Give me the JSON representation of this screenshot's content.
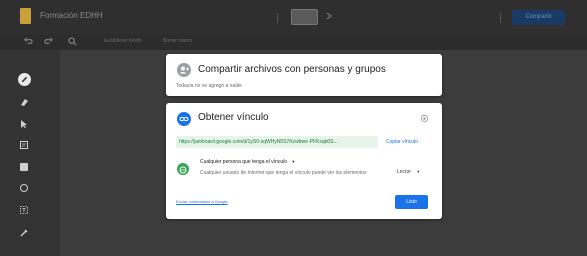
{
  "app": {
    "title": "Formación EDHH",
    "share_label": "Compartir"
  },
  "toolbar": {
    "items": [
      "Establecer fondo",
      "Borrar marco"
    ]
  },
  "share_dialog": {
    "title": "Compartir archivos con personas y grupos",
    "subtitle": "Todavía no se agregó a nadie"
  },
  "link_dialog": {
    "title": "Obtener vínculo",
    "url": "https://jamboard.google.com/d/1yS0-sqWHyN0S7Kzwbwe-PFKsqb0S...",
    "copy_label": "Copiar vínculo",
    "access_title": "Cualquier persona que tenga el vínculo",
    "access_description": "Cualquier usuario de Internet que tenga el vínculo puede ver los elementos",
    "role": "Lector",
    "feedback_label": "Enviar comentarios a Google",
    "done_label": "Listo"
  },
  "colors": {
    "accent": "#1a73e8",
    "link_green": "#188038",
    "url_bg": "#e6f4ea",
    "backdrop": "#3a3a3a"
  },
  "icons": {
    "share_person": "person-add-icon",
    "link": "link-icon",
    "settings": "gear-icon",
    "access": "globe-icon"
  }
}
